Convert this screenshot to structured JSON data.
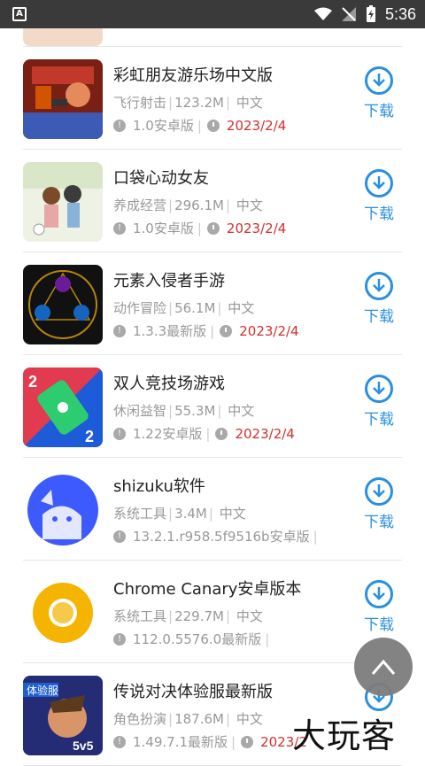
{
  "status_bar": {
    "time": "5:36"
  },
  "list": {
    "items": [
      {
        "title": "彩虹朋友游乐场中文版",
        "category": "飞行射击",
        "size": "123.2M",
        "lang": "中文",
        "version": "1.0安卓版",
        "date": "2023/2/4",
        "download": "下载"
      },
      {
        "title": "口袋心动女友",
        "category": "养成经营",
        "size": "296.1M",
        "lang": "中文",
        "version": "1.0安卓版",
        "date": "2023/2/4",
        "download": "下载"
      },
      {
        "title": "元素入侵者手游",
        "category": "动作冒险",
        "size": "56.1M",
        "lang": "中文",
        "version": "1.3.3最新版",
        "date": "2023/2/4",
        "download": "下载"
      },
      {
        "title": "双人竞技场游戏",
        "category": "休闲益智",
        "size": "55.3M",
        "lang": "中文",
        "version": "1.22安卓版",
        "date": "2023/2/4",
        "download": "下载"
      },
      {
        "title": "shizuku软件",
        "category": "系统工具",
        "size": "3.4M",
        "lang": "中文",
        "version": "13.2.1.r958.5f9516b安卓版",
        "date": "",
        "download": "下载"
      },
      {
        "title": "Chrome Canary安卓版本",
        "category": "系统工具",
        "size": "229.7M",
        "lang": "中文",
        "version": "112.0.5576.0最新版",
        "date": "",
        "download": "下载"
      },
      {
        "title": "传说对决体验服最新版",
        "category": "角色扮演",
        "size": "187.6M",
        "lang": "中文",
        "version": "1.49.7.1最新版",
        "date": "2023/2",
        "download": "下载"
      }
    ]
  },
  "thumb_badges": {
    "vs_left": "2",
    "vs_right": "2",
    "aov_tag": "体验服",
    "aov_mode": "5v5"
  },
  "watermark": "大玩客",
  "colors": {
    "accent": "#2a8fe0",
    "date": "#d32f2f"
  }
}
